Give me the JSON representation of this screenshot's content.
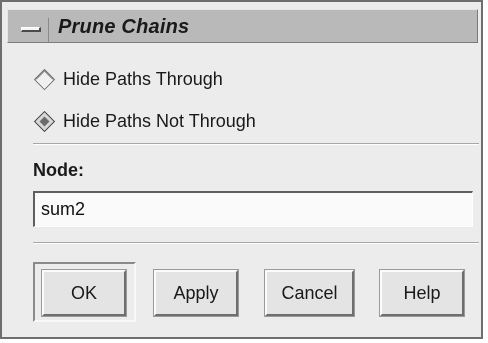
{
  "window": {
    "title": "Prune Chains"
  },
  "options": [
    {
      "label": "Hide Paths Through",
      "selected": false
    },
    {
      "label": "Hide Paths Not Through",
      "selected": true
    }
  ],
  "node": {
    "label": "Node:",
    "value": "sum2"
  },
  "buttons": {
    "ok": "OK",
    "apply": "Apply",
    "cancel": "Cancel",
    "help": "Help"
  }
}
